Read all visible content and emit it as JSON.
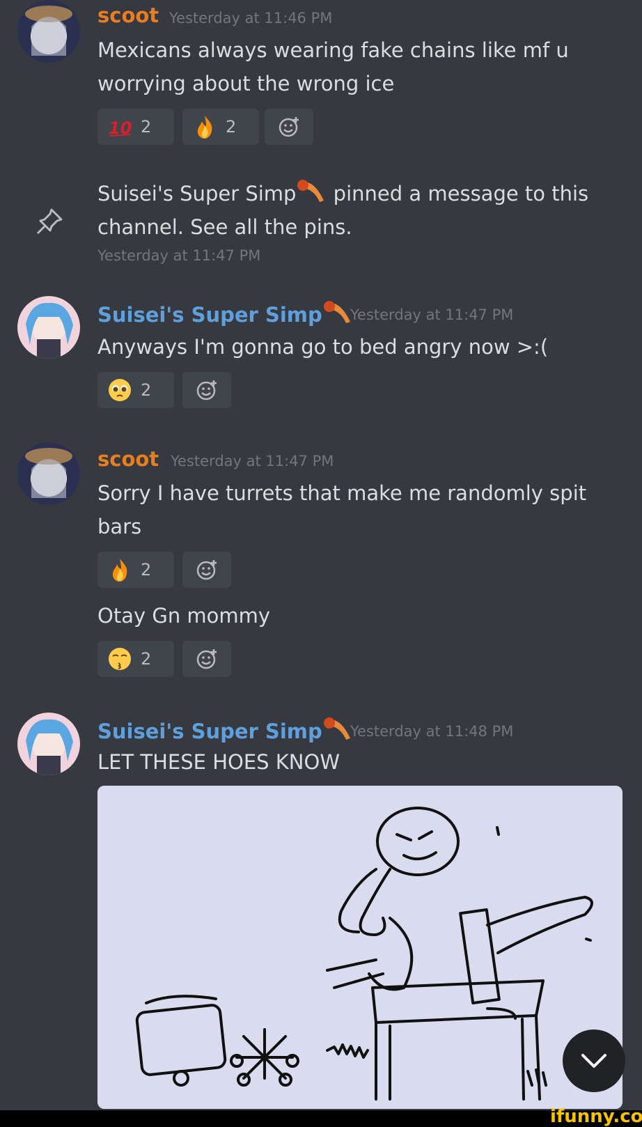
{
  "messages": [
    {
      "author": "scoot",
      "timestamp": "Yesterday at 11:46 PM",
      "lines": [
        "Mexicans always wearing fake chains like mf u",
        "worrying about the wrong ice"
      ],
      "reactions": [
        {
          "emoji": "hundred-points-icon",
          "count": "2"
        },
        {
          "emoji": "fire-icon",
          "count": "2"
        }
      ]
    },
    {
      "system": true,
      "pinned_lines": [
        "Suisei's Super Simp",
        " pinned a message to this",
        "channel. See all the pins."
      ],
      "timestamp": "Yesterday at 11:47 PM"
    },
    {
      "author": "Suisei's Super Simp",
      "timestamp": "Yesterday at 11:47 PM",
      "text": "Anyways I'm gonna go to bed angry now >:(",
      "reactions": [
        {
          "emoji": "pleading-face-icon",
          "count": "2"
        }
      ]
    },
    {
      "author": "scoot",
      "timestamp": "Yesterday at 11:47 PM",
      "lines": [
        "Sorry I have turrets that make me randomly spit",
        "bars"
      ],
      "reactions": [
        {
          "emoji": "fire-icon",
          "count": "2"
        }
      ],
      "followup_text": "Otay Gn mommy",
      "followup_reactions": [
        {
          "emoji": "kissing-face-icon",
          "count": "2"
        }
      ]
    },
    {
      "author": "Suisei's Super Simp",
      "timestamp": "Yesterday at 11:48 PM",
      "text": "LET THESE HOES KNOW",
      "attachment": "sketch-drawing-image"
    }
  ],
  "colors": {
    "background": "#36393f",
    "scoot": "#e67e22",
    "simp": "#5fa0dc",
    "timestamp": "#72767d",
    "reaction_bg": "#40444b"
  },
  "watermark": "ifunny.co"
}
